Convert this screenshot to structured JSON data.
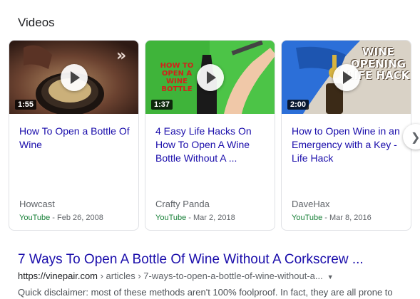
{
  "section": {
    "title": "Videos"
  },
  "videos": [
    {
      "title": "How To Open a Bottle Of Wine",
      "duration": "1:55",
      "source": "Howcast",
      "platform": "YouTube",
      "date": "- Feb 26, 2008",
      "overlay": ""
    },
    {
      "title": "4 Easy Life Hacks On How To Open A Wine Bottle Without A ...",
      "duration": "1:37",
      "source": "Crafty Panda",
      "platform": "YouTube",
      "date": "- Mar 2, 2018",
      "overlay": "HOW TO OPEN A WINE BOTTLE"
    },
    {
      "title": "How to Open Wine in an Emergency with a Key - Life Hack",
      "duration": "2:00",
      "source": "DaveHax",
      "platform": "YouTube",
      "date": "- Mar 8, 2016",
      "overlay": "WINE OPENING LIFE HACK"
    }
  ],
  "next_button": {
    "icon": "chevron-right-icon"
  },
  "result": {
    "title": "7 Ways To Open A Bottle Of Wine Without A Corkscrew ...",
    "url_host": "https://vinepair.com",
    "url_path": " › articles › 7-ways-to-open-a-bottle-of-wine-without-a...",
    "snippet": "Quick disclaimer: most of these methods aren't 100% foolproof. In fact, they are all prone to"
  },
  "colors": {
    "link": "#1a0dab",
    "youtube": "#188038",
    "card_border": "#dfe1e5"
  }
}
